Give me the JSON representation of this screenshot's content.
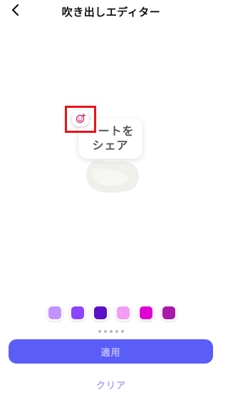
{
  "header": {
    "title": "吹き出しエディター",
    "back_icon": "chevron-left-icon"
  },
  "bubble": {
    "line1": "ートを",
    "line2": "シェア"
  },
  "sticker_button": {
    "icon": "add-emoji-icon",
    "accent": "#e0287a"
  },
  "highlight_color": "#e8141a",
  "palette": [
    {
      "color": "#c293ff"
    },
    {
      "color": "#8c44ff"
    },
    {
      "color": "#5a10c9"
    },
    {
      "color": "#f49bf4"
    },
    {
      "color": "#e000d6"
    },
    {
      "color": "#a81aa8"
    }
  ],
  "pager": {
    "count": 5
  },
  "apply_button": {
    "label": "適用",
    "bg": "#5b5df7",
    "text_color": "#b8b9ff"
  },
  "clear_button": {
    "label": "クリア",
    "text_color": "#a9aaf7"
  }
}
